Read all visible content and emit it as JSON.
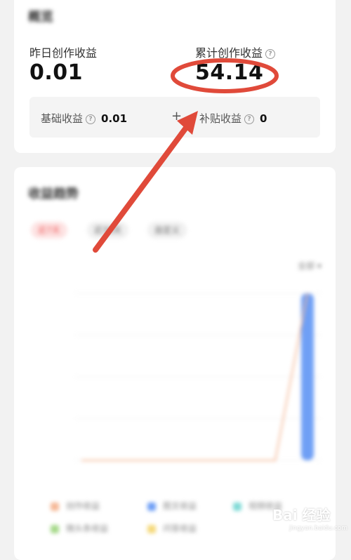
{
  "overview": {
    "title": "概览",
    "yesterday_label": "昨日创作收益",
    "yesterday_value": "0.01",
    "total_label": "累计创作收益",
    "total_value": "54.14",
    "basic_label": "基础收益",
    "basic_value": "0.01",
    "plus": "+",
    "subsidy_label": "补贴收益",
    "subsidy_value": "0",
    "help_glyph": "?"
  },
  "trend": {
    "title": "收益趋势",
    "tabs": [
      "近7天",
      "近30天",
      "自定义"
    ],
    "active_tab": 0,
    "filter": "全部",
    "legend": [
      {
        "label": "创作收益",
        "color": "#f5b896"
      },
      {
        "label": "图文收益",
        "color": "#6f9ff5"
      },
      {
        "label": "视频收益",
        "color": "#7fdad6"
      },
      {
        "label": "微头条收益",
        "color": "#a6d98a"
      },
      {
        "label": "问答收益",
        "color": "#f5d97a"
      }
    ]
  },
  "chart_data": {
    "type": "line",
    "x": [
      "",
      "",
      "",
      "",
      "",
      "",
      "",
      ""
    ],
    "series": [
      {
        "values": [
          0,
          0,
          0,
          0,
          0,
          0,
          0,
          54.14
        ]
      }
    ],
    "bars": [
      0,
      0,
      0,
      0,
      0,
      0,
      0,
      54.14
    ],
    "bar_color": "#6f9ff5",
    "line_color": "#f5b896"
  },
  "watermark": {
    "text": "Bai 经验",
    "sub": "jingyan.baidu.com"
  },
  "annotation_color": "#e04a3a"
}
